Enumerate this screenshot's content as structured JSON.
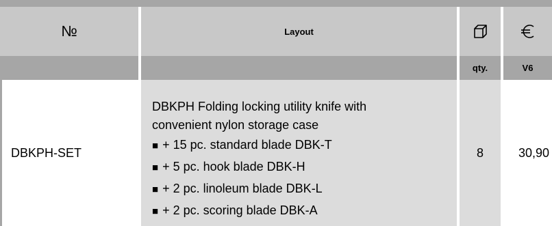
{
  "header": {
    "no_label": "№",
    "layout_label": "Layout",
    "box_icon": "box-icon",
    "currency_icon": "euro-icon"
  },
  "subheader": {
    "qty_label": "qty.",
    "price_label": "V6"
  },
  "row": {
    "article_no": "DBKPH-SET",
    "description_lines": [
      "DBKPH Folding locking utility knife with",
      "convenient nylon storage case"
    ],
    "items": [
      "+ 15 pc. standard blade DBK-T",
      "+ 5 pc. hook blade DBK-H",
      "+ 2 pc. linoleum blade DBK-L",
      "+ 2 pc. scoring blade DBK-A"
    ],
    "bullet": "■",
    "qty": "8",
    "price": "30,90"
  },
  "colors": {
    "header_bg": "#c8c8c8",
    "subheader_bg": "#a6a6a6",
    "description_bg": "#dcdcdc"
  }
}
